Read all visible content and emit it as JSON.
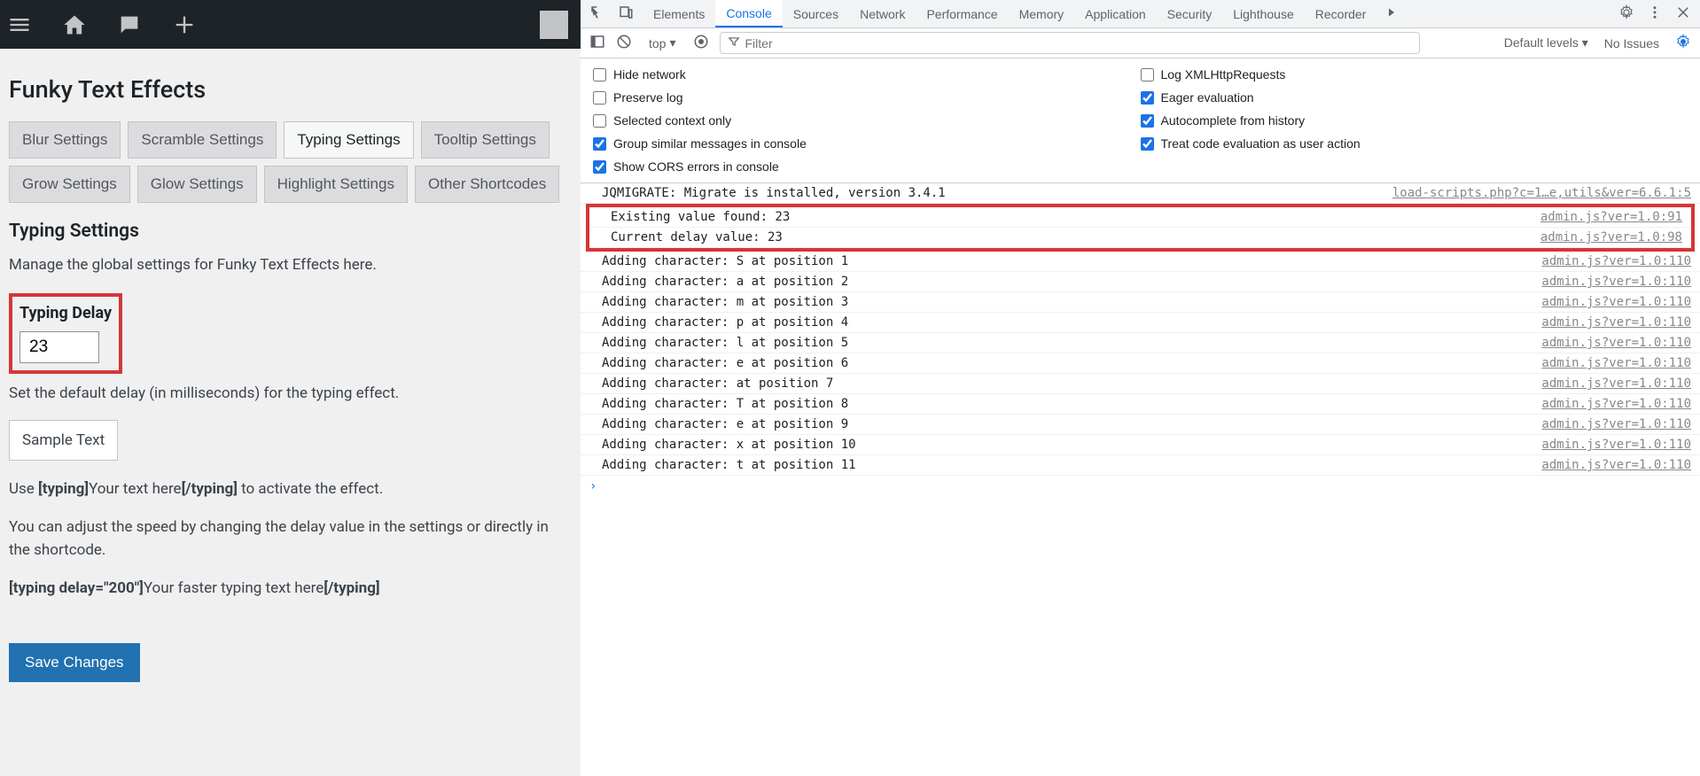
{
  "wp": {
    "title": "Funky Text Effects",
    "tabs": [
      "Blur Settings",
      "Scramble Settings",
      "Typing Settings",
      "Tooltip Settings",
      "Grow Settings",
      "Glow Settings",
      "Highlight Settings",
      "Other Shortcodes"
    ],
    "active_tab": 2,
    "section_title": "Typing Settings",
    "section_desc": "Manage the global settings for Funky Text Effects here.",
    "field_label": "Typing Delay",
    "field_value": "23",
    "field_help": "Set the default delay (in milliseconds) for the typing effect.",
    "preview_text": "Sample Text",
    "usage_pre": "Use ",
    "usage_open": "[typing]",
    "usage_mid": "Your text here",
    "usage_close": "[/typing]",
    "usage_post": " to activate the effect.",
    "adjust_text": "You can adjust the speed by changing the delay value in the settings or directly in the shortcode.",
    "example_open": "[typing delay=\"200\"]",
    "example_mid": "Your faster typing text here",
    "example_close": "[/typing]",
    "save_label": "Save Changes"
  },
  "devtools": {
    "tabs": [
      "Elements",
      "Console",
      "Sources",
      "Network",
      "Performance",
      "Memory",
      "Application",
      "Security",
      "Lighthouse",
      "Recorder"
    ],
    "active_tab": 1,
    "context": "top",
    "filter_placeholder": "Filter",
    "levels": "Default levels",
    "issues": "No Issues",
    "settings": {
      "left": [
        {
          "label": "Hide network",
          "checked": false
        },
        {
          "label": "Preserve log",
          "checked": false
        },
        {
          "label": "Selected context only",
          "checked": false
        },
        {
          "label": "Group similar messages in console",
          "checked": true
        },
        {
          "label": "Show CORS errors in console",
          "checked": true
        }
      ],
      "right": [
        {
          "label": "Log XMLHttpRequests",
          "checked": false
        },
        {
          "label": "Eager evaluation",
          "checked": true
        },
        {
          "label": "Autocomplete from history",
          "checked": true
        },
        {
          "label": "Treat code evaluation as user action",
          "checked": true
        }
      ]
    },
    "log_top": {
      "msg": "JQMIGRATE: Migrate is installed, version 3.4.1",
      "src": "load-scripts.php?c=1…e,utils&ver=6.6.1:5"
    },
    "log_highlight": [
      {
        "msg": "Existing value found: 23",
        "src": "admin.js?ver=1.0:91"
      },
      {
        "msg": "Current delay value: 23",
        "src": "admin.js?ver=1.0:98"
      }
    ],
    "log_rest": [
      {
        "msg": "Adding character: S at position 1",
        "src": "admin.js?ver=1.0:110"
      },
      {
        "msg": "Adding character: a at position 2",
        "src": "admin.js?ver=1.0:110"
      },
      {
        "msg": "Adding character: m at position 3",
        "src": "admin.js?ver=1.0:110"
      },
      {
        "msg": "Adding character: p at position 4",
        "src": "admin.js?ver=1.0:110"
      },
      {
        "msg": "Adding character: l at position 5",
        "src": "admin.js?ver=1.0:110"
      },
      {
        "msg": "Adding character: e at position 6",
        "src": "admin.js?ver=1.0:110"
      },
      {
        "msg": "Adding character:   at position 7",
        "src": "admin.js?ver=1.0:110"
      },
      {
        "msg": "Adding character: T at position 8",
        "src": "admin.js?ver=1.0:110"
      },
      {
        "msg": "Adding character: e at position 9",
        "src": "admin.js?ver=1.0:110"
      },
      {
        "msg": "Adding character: x at position 10",
        "src": "admin.js?ver=1.0:110"
      },
      {
        "msg": "Adding character: t at position 11",
        "src": "admin.js?ver=1.0:110"
      }
    ]
  }
}
